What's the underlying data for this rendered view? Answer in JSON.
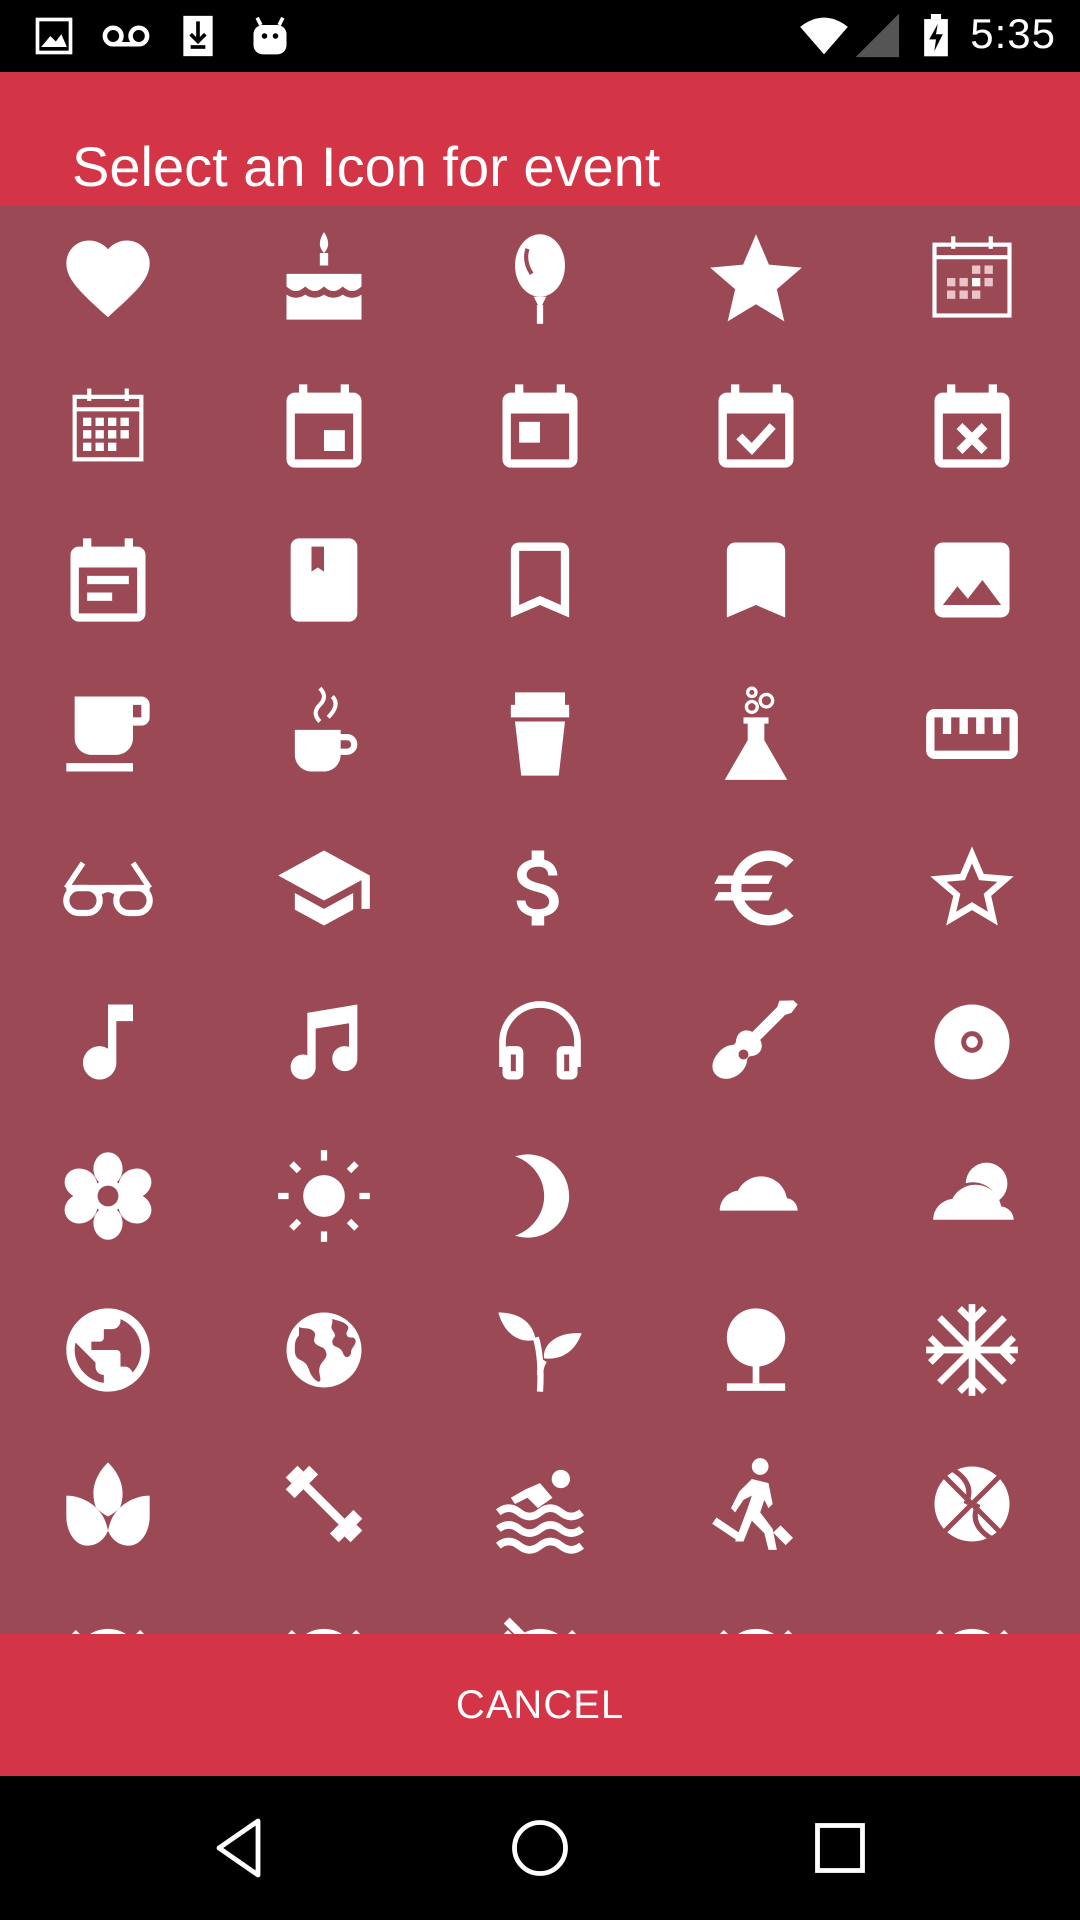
{
  "status_bar": {
    "time": "5:35",
    "left_icons": [
      "image-notification-icon",
      "voicemail-icon",
      "download-icon",
      "android-icon"
    ],
    "right_icons": [
      "wifi-icon",
      "cell-signal-icon",
      "battery-charging-icon"
    ]
  },
  "dialog": {
    "title": "Select an Icon for event",
    "cancel_label": "CANCEL",
    "colors": {
      "header": "#D33546",
      "grid_background": "#9B4A55",
      "icon": "#FFFFFF"
    }
  },
  "icons": [
    [
      "heart-icon",
      "birthday-cake-icon",
      "balloon-icon",
      "star-filled-icon",
      "calendar-grid-icon"
    ],
    [
      "calendar-small-grid-icon",
      "calendar-event-icon",
      "calendar-today-icon",
      "calendar-check-icon",
      "calendar-cancel-icon"
    ],
    [
      "calendar-note-icon",
      "book-icon",
      "bookmark-outline-icon",
      "bookmark-filled-icon",
      "image-icon"
    ],
    [
      "coffee-mug-icon",
      "hot-drink-icon",
      "takeaway-cup-icon",
      "lab-flask-icon",
      "ruler-icon"
    ],
    [
      "glasses-icon",
      "graduation-cap-icon",
      "dollar-icon",
      "euro-icon",
      "star-outline-icon"
    ],
    [
      "music-note-icon",
      "music-notes-icon",
      "headphones-icon",
      "guitar-icon",
      "disc-icon"
    ],
    [
      "flower-icon",
      "sun-icon",
      "moon-icon",
      "cloud-icon",
      "partly-cloudy-icon"
    ],
    [
      "globe-icon",
      "world-map-icon",
      "sprout-icon",
      "tree-icon",
      "snowflake-icon"
    ],
    [
      "lotus-icon",
      "dumbbell-icon",
      "swimming-icon",
      "hiking-icon",
      "basketball-icon"
    ],
    [
      "alarm-clock-icon",
      "alarm-off-icon",
      "alarm-icon",
      "alarm-add-icon",
      "alarm-snooze-icon"
    ]
  ],
  "nav_bar": {
    "buttons": [
      "back-icon",
      "home-icon",
      "recents-icon"
    ]
  }
}
